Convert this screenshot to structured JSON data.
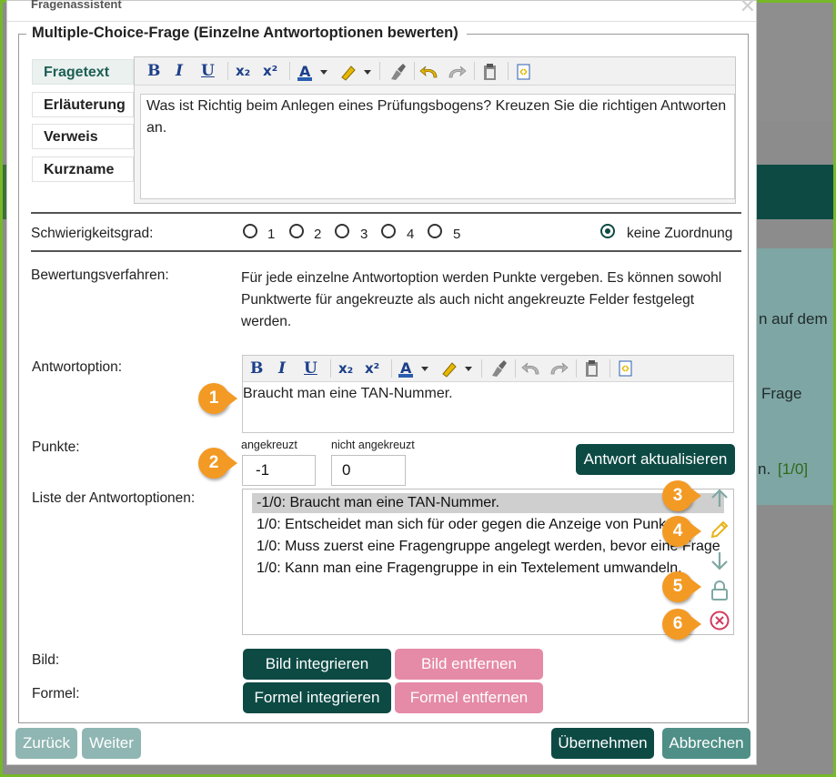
{
  "dialog": {
    "title": "Fragenassistent",
    "close_icon": "close-icon"
  },
  "background": {
    "text_right_1": "n auf dem",
    "text_right_2": "Frage",
    "text_right_3": "n.",
    "link_right": "[1/0]"
  },
  "fieldset": {
    "legend": "Multiple-Choice-Frage (Einzelne Antwortoptionen bewerten)"
  },
  "tabs": [
    {
      "label": "Fragetext",
      "active": true
    },
    {
      "label": "Erläuterung",
      "active": false
    },
    {
      "label": "Verweis",
      "active": false
    },
    {
      "label": "Kurzname",
      "active": false
    }
  ],
  "toolbar": {
    "bold": "B",
    "italic": "I",
    "underline": "U",
    "subscript": "x₂",
    "superscript": "x²"
  },
  "question_editor": {
    "text": "Was ist Richtig beim Anlegen eines Prüfungsbogens? Kreuzen Sie die richtigen Antworten an."
  },
  "difficulty": {
    "label": "Schwierigkeitsgrad:",
    "options": [
      "1",
      "2",
      "3",
      "4",
      "5"
    ],
    "none_label": "keine Zuordnung",
    "selected": "keine Zuordnung"
  },
  "scoring": {
    "label": "Bewertungsverfahren:",
    "text": "Für jede einzelne Antwortoption werden Punkte vergeben. Es können sowohl Punktwerte für angekreuzte als auch nicht angekreuzte Felder festgelegt werden."
  },
  "answer_option": {
    "label": "Antwortoption:",
    "text": "Braucht man eine TAN-Nummer."
  },
  "points": {
    "label": "Punkte:",
    "checked_label": "angekreuzt",
    "checked_value": "-1",
    "unchecked_label": "nicht angekreuzt",
    "unchecked_value": "0",
    "update_button": "Antwort aktualisieren"
  },
  "answer_list": {
    "label": "Liste der Antwortoptionen:",
    "items": [
      "-1/0: Braucht man eine TAN-Nummer.",
      "1/0: Entscheidet man sich für oder gegen die Anzeige von Punkten",
      "1/0: Muss zuerst eine Fragengruppe angelegt werden, bevor eine Frage",
      "1/0: Kann man eine Fragengruppe in ein Textelement umwandeln."
    ],
    "selected_index": 0
  },
  "image": {
    "label": "Bild:",
    "integrate_button": "Bild integrieren",
    "remove_button": "Bild entfernen"
  },
  "formula": {
    "label": "Formel:",
    "integrate_button": "Formel integrieren",
    "remove_button": "Formel entfernen"
  },
  "footer": {
    "back_button": "Zurück",
    "next_button": "Weiter",
    "apply_button": "Übernehmen",
    "cancel_button": "Abbrechen"
  },
  "markers": [
    "1",
    "2",
    "3",
    "4",
    "5",
    "6"
  ],
  "colors": {
    "primary": "#0d4a44",
    "danger_light": "#e58aa7",
    "disabled": "#8fb6b2",
    "marker": "#f39a24",
    "frame": "#76b82a"
  }
}
